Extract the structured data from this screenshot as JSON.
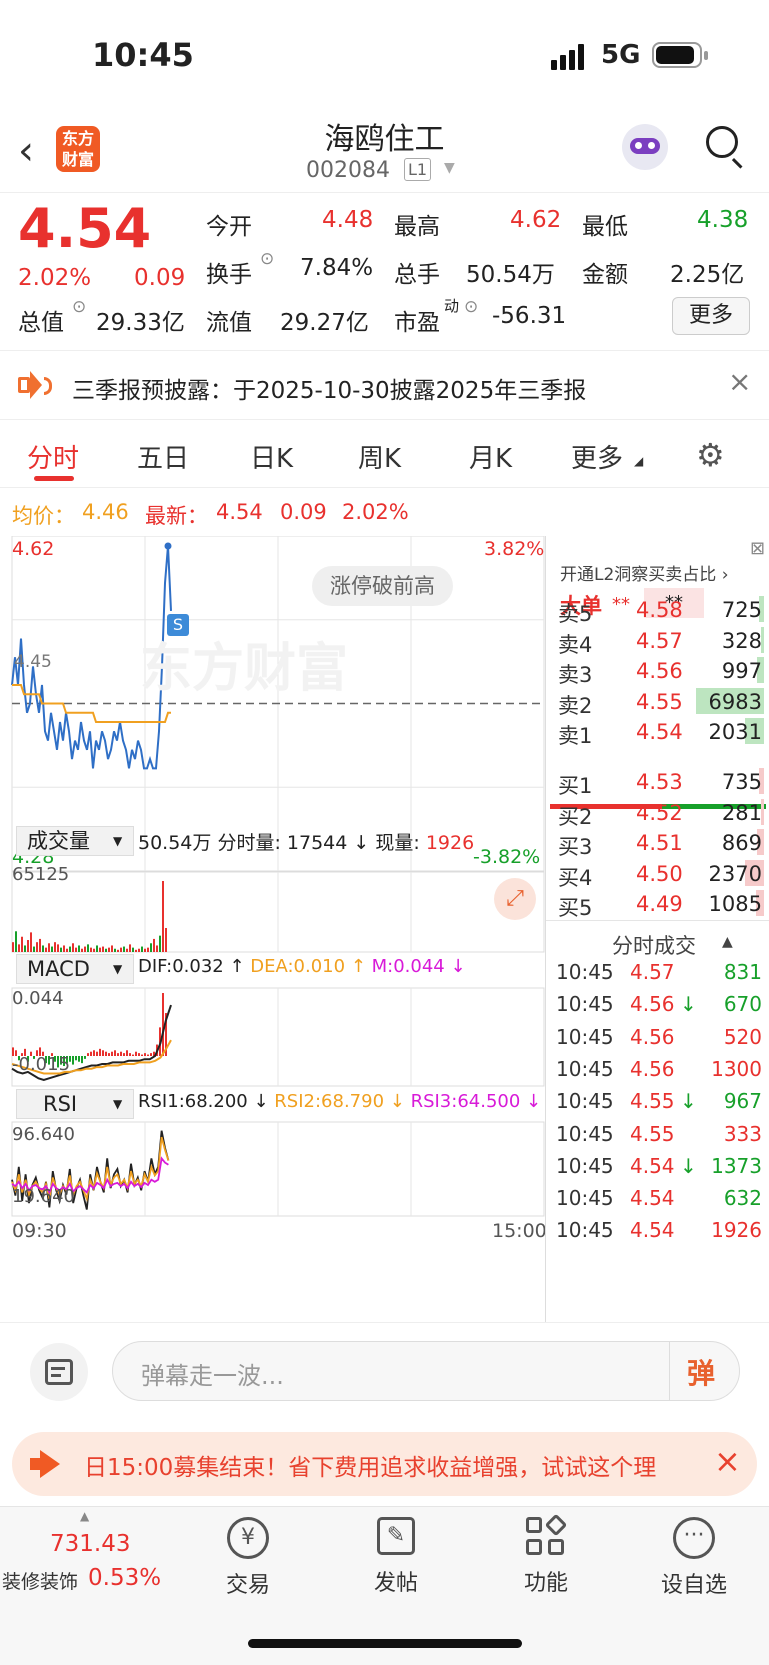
{
  "status_bar": {
    "time": "10:45",
    "network": "5G"
  },
  "header": {
    "title": "海鸥住工",
    "code": "002084",
    "level": "L1",
    "app_logo_text": "东方财富"
  },
  "quote": {
    "price": "4.54",
    "change_pct": "2.02%",
    "change": "0.09",
    "open_label": "今开",
    "open": "4.48",
    "high_label": "最高",
    "high": "4.62",
    "low_label": "最低",
    "low": "4.38",
    "turnover_label": "换手",
    "turnover": "7.84%",
    "volume_label": "总手",
    "volume": "50.54万",
    "amount_label": "金额",
    "amount": "2.25亿",
    "mktcap_label": "总值",
    "mktcap": "29.33亿",
    "float_label": "流值",
    "float": "29.27亿",
    "pe_label": "市盈",
    "pe_sup": "动",
    "pe": "-56.31",
    "more_button": "更多"
  },
  "notice": {
    "text": "三季报预披露：于2025-10-30披露2025年三季报"
  },
  "tabs": [
    "分时",
    "五日",
    "日K",
    "周K",
    "月K",
    "更多"
  ],
  "avg_line": {
    "avg_label": "均价：",
    "avg": "4.46",
    "last_label": "最新：",
    "last": "4.54",
    "chg": "0.09",
    "pct": "2.02%"
  },
  "chart_data": {
    "type": "line",
    "price_axis": {
      "top": "4.62",
      "bottom": "4.28",
      "mid": "4.45",
      "top_pct": "3.82%",
      "bottom_pct": "-3.82%"
    },
    "badge": "涨停破前高",
    "watermark": "东方财富",
    "signal": "S",
    "x_start": "09:30",
    "x_end": "15:00",
    "price_series": [
      4.47,
      4.5,
      4.47,
      4.52,
      4.47,
      4.44,
      4.45,
      4.49,
      4.46,
      4.44,
      4.47,
      4.42,
      4.41,
      4.44,
      4.42,
      4.4,
      4.43,
      4.41,
      4.44,
      4.42,
      4.39,
      4.41,
      4.4,
      4.43,
      4.41,
      4.4,
      4.42,
      4.38,
      4.41,
      4.4,
      4.42,
      4.41,
      4.39,
      4.4,
      4.42,
      4.41,
      4.43,
      4.41,
      4.4,
      4.38,
      4.4,
      4.39,
      4.41,
      4.4,
      4.38,
      4.38,
      4.39,
      4.38,
      4.38,
      4.42,
      4.49,
      4.58,
      4.62,
      4.55
    ],
    "avg_series": [
      4.47,
      4.47,
      4.47,
      4.47,
      4.46,
      4.46,
      4.46,
      4.46,
      4.46,
      4.46,
      4.45,
      4.45,
      4.45,
      4.45,
      4.45,
      4.45,
      4.45,
      4.45,
      4.44,
      4.44,
      4.44,
      4.44,
      4.44,
      4.44,
      4.44,
      4.44,
      4.44,
      4.44,
      4.43,
      4.43,
      4.43,
      4.43,
      4.43,
      4.43,
      4.43,
      4.43,
      4.43,
      4.43,
      4.43,
      4.43,
      4.43,
      4.43,
      4.43,
      4.43,
      4.43,
      4.43,
      4.43,
      4.43,
      4.43,
      4.43,
      4.43,
      4.43,
      4.44,
      4.44
    ],
    "volume": {
      "selector": "成交量",
      "total": "50.54万",
      "period_label": "分时量:",
      "period": "17544",
      "now_label": "现量:",
      "now": "1926",
      "max": "65125",
      "values": [
        9000,
        19000,
        7000,
        14000,
        6000,
        11000,
        18000,
        5000,
        9000,
        12000,
        6000,
        4000,
        8000,
        5000,
        9000,
        7000,
        4000,
        6000,
        3000,
        5000,
        8000,
        4000,
        6000,
        3000,
        5000,
        7000,
        4000,
        3000,
        6000,
        4000,
        5000,
        3000,
        4000,
        6000,
        3000,
        2000,
        4000,
        5000,
        3000,
        7000,
        4000,
        2000,
        3000,
        5000,
        3000,
        4000,
        8000,
        12000,
        6000,
        15000,
        65125,
        22000
      ]
    },
    "macd": {
      "selector": "MACD",
      "dif": "DIF:0.032",
      "dea": "DEA:0.010",
      "m": "M:0.044",
      "top": "0.044",
      "bottom": "-0.015",
      "hist": [
        0.006,
        0.004,
        -0.003,
        0.002,
        0.005,
        -0.004,
        0.003,
        -0.002,
        0.004,
        0.006,
        0.003,
        -0.005,
        -0.006,
        0.002,
        -0.004,
        -0.008,
        -0.006,
        -0.007,
        -0.005,
        -0.004,
        -0.006,
        -0.003,
        -0.004,
        -0.005,
        -0.002,
        0.002,
        0.003,
        0.004,
        0.003,
        0.005,
        0.004,
        0.003,
        0.002,
        0.003,
        0.004,
        0.002,
        0.003,
        0.002,
        0.004,
        0.002,
        0.001,
        0.003,
        0.002,
        0.001,
        0.002,
        0.001,
        0.002,
        0.003,
        0.008,
        0.02,
        0.044,
        0.03
      ],
      "dif_series": [
        -0.008,
        -0.01,
        -0.011,
        -0.01,
        -0.012,
        -0.014,
        -0.015,
        -0.014,
        -0.013,
        -0.012,
        -0.011,
        -0.01,
        -0.009,
        -0.008,
        -0.007,
        -0.006,
        -0.006,
        -0.005,
        -0.005,
        -0.004,
        -0.004,
        -0.004,
        -0.003,
        -0.003,
        -0.003,
        -0.002,
        -0.002,
        0.0,
        0.008,
        0.022,
        0.032
      ],
      "dea_series": [
        -0.005,
        -0.006,
        -0.007,
        -0.008,
        -0.009,
        -0.01,
        -0.011,
        -0.011,
        -0.011,
        -0.011,
        -0.01,
        -0.01,
        -0.009,
        -0.009,
        -0.008,
        -0.008,
        -0.007,
        -0.007,
        -0.006,
        -0.006,
        -0.006,
        -0.005,
        -0.005,
        -0.005,
        -0.004,
        -0.004,
        -0.004,
        -0.003,
        -0.001,
        0.004,
        0.01
      ]
    },
    "rsi": {
      "selector": "RSI",
      "rsi1": "RSI1:68.200",
      "rsi2": "RSI2:68.790",
      "rsi3": "RSI3:64.500",
      "top": "96.640",
      "bottom": "19.640",
      "rsi1_series": [
        50,
        35,
        62,
        30,
        55,
        28,
        45,
        52,
        40,
        33,
        48,
        24,
        58,
        40,
        30,
        45,
        36,
        60,
        28,
        42,
        50,
        35,
        22,
        55,
        40,
        62,
        48,
        38,
        70,
        42,
        55,
        60,
        44,
        50,
        38,
        65,
        45,
        52,
        40,
        58,
        48,
        70,
        55,
        62,
        96,
        80,
        68
      ],
      "rsi2_series": [
        48,
        40,
        55,
        38,
        50,
        36,
        44,
        48,
        42,
        38,
        46,
        32,
        52,
        42,
        36,
        44,
        40,
        54,
        36,
        44,
        48,
        40,
        32,
        50,
        42,
        56,
        48,
        42,
        62,
        45,
        52,
        55,
        46,
        50,
        42,
        58,
        46,
        50,
        44,
        55,
        48,
        62,
        54,
        58,
        90,
        78,
        68
      ],
      "rsi3_series": [
        46,
        44,
        48,
        42,
        46,
        40,
        44,
        45,
        42,
        41,
        44,
        38,
        46,
        42,
        40,
        43,
        41,
        46,
        39,
        42,
        44,
        41,
        38,
        45,
        42,
        47,
        45,
        42,
        50,
        44,
        46,
        47,
        44,
        46,
        42,
        48,
        44,
        46,
        43,
        47,
        45,
        50,
        48,
        50,
        70,
        66,
        64
      ]
    }
  },
  "book": {
    "promo": "开通L2洞察买卖占比",
    "big_label": "大单",
    "big_a": "**",
    "big_b": "**",
    "asks": [
      {
        "label": "卖5",
        "price": "4.58",
        "vol": "725",
        "ratio": 0.08
      },
      {
        "label": "卖4",
        "price": "4.57",
        "vol": "328",
        "ratio": 0.04
      },
      {
        "label": "卖3",
        "price": "4.56",
        "vol": "997",
        "ratio": 0.1
      },
      {
        "label": "卖2",
        "price": "4.55",
        "vol": "6983",
        "ratio": 1.0
      },
      {
        "label": "卖1",
        "price": "4.54",
        "vol": "2031",
        "ratio": 0.28
      }
    ],
    "bids": [
      {
        "label": "买1",
        "price": "4.53",
        "vol": "735",
        "ratio": 0.08
      },
      {
        "label": "买2",
        "price": "4.52",
        "vol": "281",
        "ratio": 0.04
      },
      {
        "label": "买3",
        "price": "4.51",
        "vol": "869",
        "ratio": 0.1
      },
      {
        "label": "买4",
        "price": "4.50",
        "vol": "2370",
        "ratio": 0.28
      },
      {
        "label": "买5",
        "price": "4.49",
        "vol": "1085",
        "ratio": 0.12
      }
    ],
    "ticks_title": "分时成交",
    "ticks": [
      {
        "time": "10:45",
        "price": "4.57",
        "arrow": "",
        "vol": "831",
        "color": "green"
      },
      {
        "time": "10:45",
        "price": "4.56",
        "arrow": "↓",
        "vol": "670",
        "color": "green"
      },
      {
        "time": "10:45",
        "price": "4.56",
        "arrow": "",
        "vol": "520",
        "color": "red"
      },
      {
        "time": "10:45",
        "price": "4.56",
        "arrow": "",
        "vol": "1300",
        "color": "red"
      },
      {
        "time": "10:45",
        "price": "4.55",
        "arrow": "↓",
        "vol": "967",
        "color": "green"
      },
      {
        "time": "10:45",
        "price": "4.55",
        "arrow": "",
        "vol": "333",
        "color": "red"
      },
      {
        "time": "10:45",
        "price": "4.54",
        "arrow": "↓",
        "vol": "1373",
        "color": "green"
      },
      {
        "time": "10:45",
        "price": "4.54",
        "arrow": "",
        "vol": "632",
        "color": "green"
      },
      {
        "time": "10:45",
        "price": "4.54",
        "arrow": "",
        "vol": "1926",
        "color": "red"
      }
    ]
  },
  "comment": {
    "placeholder": "弹幕走一波...",
    "send_glyph": "弹"
  },
  "ad": {
    "text": "日15:00募集结束！省下费用追求收益增强，试试这个理"
  },
  "nav": {
    "index_value": "731.43",
    "index_name": "装修装饰",
    "index_pct": "0.53%",
    "items": [
      {
        "label": "交易",
        "icon": "trade-icon"
      },
      {
        "label": "发帖",
        "icon": "post-icon"
      },
      {
        "label": "功能",
        "icon": "apps-icon"
      },
      {
        "label": "设自选",
        "icon": "more-icon"
      }
    ]
  }
}
